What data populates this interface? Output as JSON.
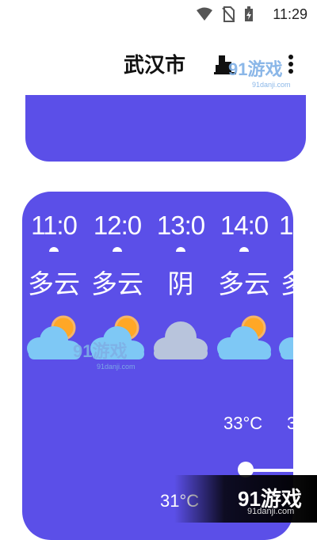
{
  "status": {
    "time": "11:29",
    "icons": [
      "wifi-icon",
      "no-sim-icon",
      "battery-charging-icon"
    ]
  },
  "header": {
    "city": "武汉市",
    "city_icon": "city-buildings-icon",
    "menu_icon": "more-vert-icon"
  },
  "watermark": {
    "brand": "91游戏",
    "site": "91danji.com"
  },
  "hourly": [
    {
      "time": "11:0",
      "condition": "多云",
      "icon": "partly-cloudy-icon"
    },
    {
      "time": "12:0",
      "condition": "多云",
      "icon": "partly-cloudy-icon"
    },
    {
      "time": "13:0",
      "condition": "阴",
      "icon": "overcast-icon"
    },
    {
      "time": "14:0",
      "condition": "多云",
      "icon": "partly-cloudy-icon"
    },
    {
      "time": "1",
      "condition": "多",
      "icon": "partly-cloudy-icon"
    }
  ],
  "temps": {
    "high_a": "33°C",
    "high_b": "3",
    "low_a": "31°C"
  },
  "colors": {
    "card": "#5b4fe8",
    "sun": "#ffa726",
    "cloud": "#7ec8f5",
    "overcast": "#b8c4dc"
  }
}
